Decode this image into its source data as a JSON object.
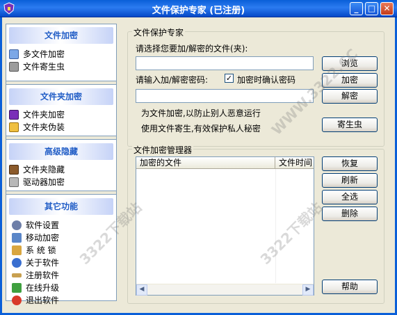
{
  "window": {
    "title": "文件保护专家 (已注册)",
    "min_label": "_",
    "max_label": "□",
    "close_label": "✕"
  },
  "sidebar": {
    "sections": [
      {
        "header": "文件加密",
        "items": [
          {
            "label": "多文件加密",
            "icon": "multi-file-encrypt-icon"
          },
          {
            "label": "文件寄生虫",
            "icon": "file-parasite-icon"
          }
        ]
      },
      {
        "header": "文件夹加密",
        "items": [
          {
            "label": "文件夹加密",
            "icon": "folder-encrypt-icon"
          },
          {
            "label": "文件夹伪装",
            "icon": "folder-disguise-icon"
          }
        ]
      },
      {
        "header": "高级隐藏",
        "items": [
          {
            "label": "文件夹隐藏",
            "icon": "folder-hide-icon"
          },
          {
            "label": "驱动器加密",
            "icon": "drive-encrypt-icon"
          }
        ]
      },
      {
        "header": "其它功能",
        "items": [
          {
            "label": "软件设置",
            "icon": "settings-gear-icon"
          },
          {
            "label": "移动加密",
            "icon": "mobile-encrypt-icon"
          },
          {
            "label": "系 统 锁",
            "icon": "system-lock-icon"
          },
          {
            "label": "关于软件",
            "icon": "about-info-icon"
          },
          {
            "label": "注册软件",
            "icon": "register-key-icon"
          },
          {
            "label": "在线升级",
            "icon": "online-update-icon"
          },
          {
            "label": "退出软件",
            "icon": "exit-icon"
          }
        ]
      }
    ]
  },
  "protect": {
    "group_title": "文件保护专家",
    "file_label": "请选择您要加/解密的文件(夹):",
    "file_value": "",
    "password_label": "请输入加/解密密码:",
    "confirm_checkbox_label": "加密时确认密码",
    "confirm_checked": true,
    "password_value": "",
    "hint1": "为文件加密,以防止别人恶意运行",
    "hint2": "使用文件寄生,有效保护私人秘密",
    "browse_btn": "浏览",
    "encrypt_btn": "加密",
    "decrypt_btn": "解密",
    "parasite_btn": "寄生虫"
  },
  "manager": {
    "group_title": "文件加密管理器",
    "columns": [
      "加密的文件",
      "文件时间"
    ],
    "rows": [],
    "restore_btn": "恢复",
    "refresh_btn": "刷新",
    "selectall_btn": "全选",
    "delete_btn": "删除",
    "help_btn": "帮助"
  },
  "watermark": {
    "text": "3322下载站",
    "url_text": "WWW.3322.CC"
  },
  "colors": {
    "titlebar": "#0A5FD8",
    "sidebar_header_text": "#215DC6",
    "face": "#ECE9D8"
  }
}
